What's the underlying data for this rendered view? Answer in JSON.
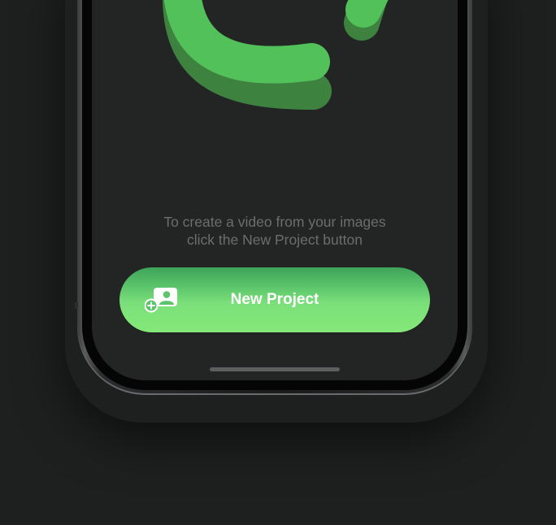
{
  "hint": {
    "line1": "To create a video from your images",
    "line2": "click the New Project button"
  },
  "new_project": {
    "label": "New Project",
    "icon": "add-photo-icon"
  },
  "colors": {
    "background": "#1e1f1f",
    "screen": "#232424",
    "accent_green": "#5cc46b",
    "accent_green_light": "#84e878",
    "logo_green": "#52c15a",
    "logo_shadow": "#3e8240",
    "hint_text": "#6c6d6e"
  }
}
